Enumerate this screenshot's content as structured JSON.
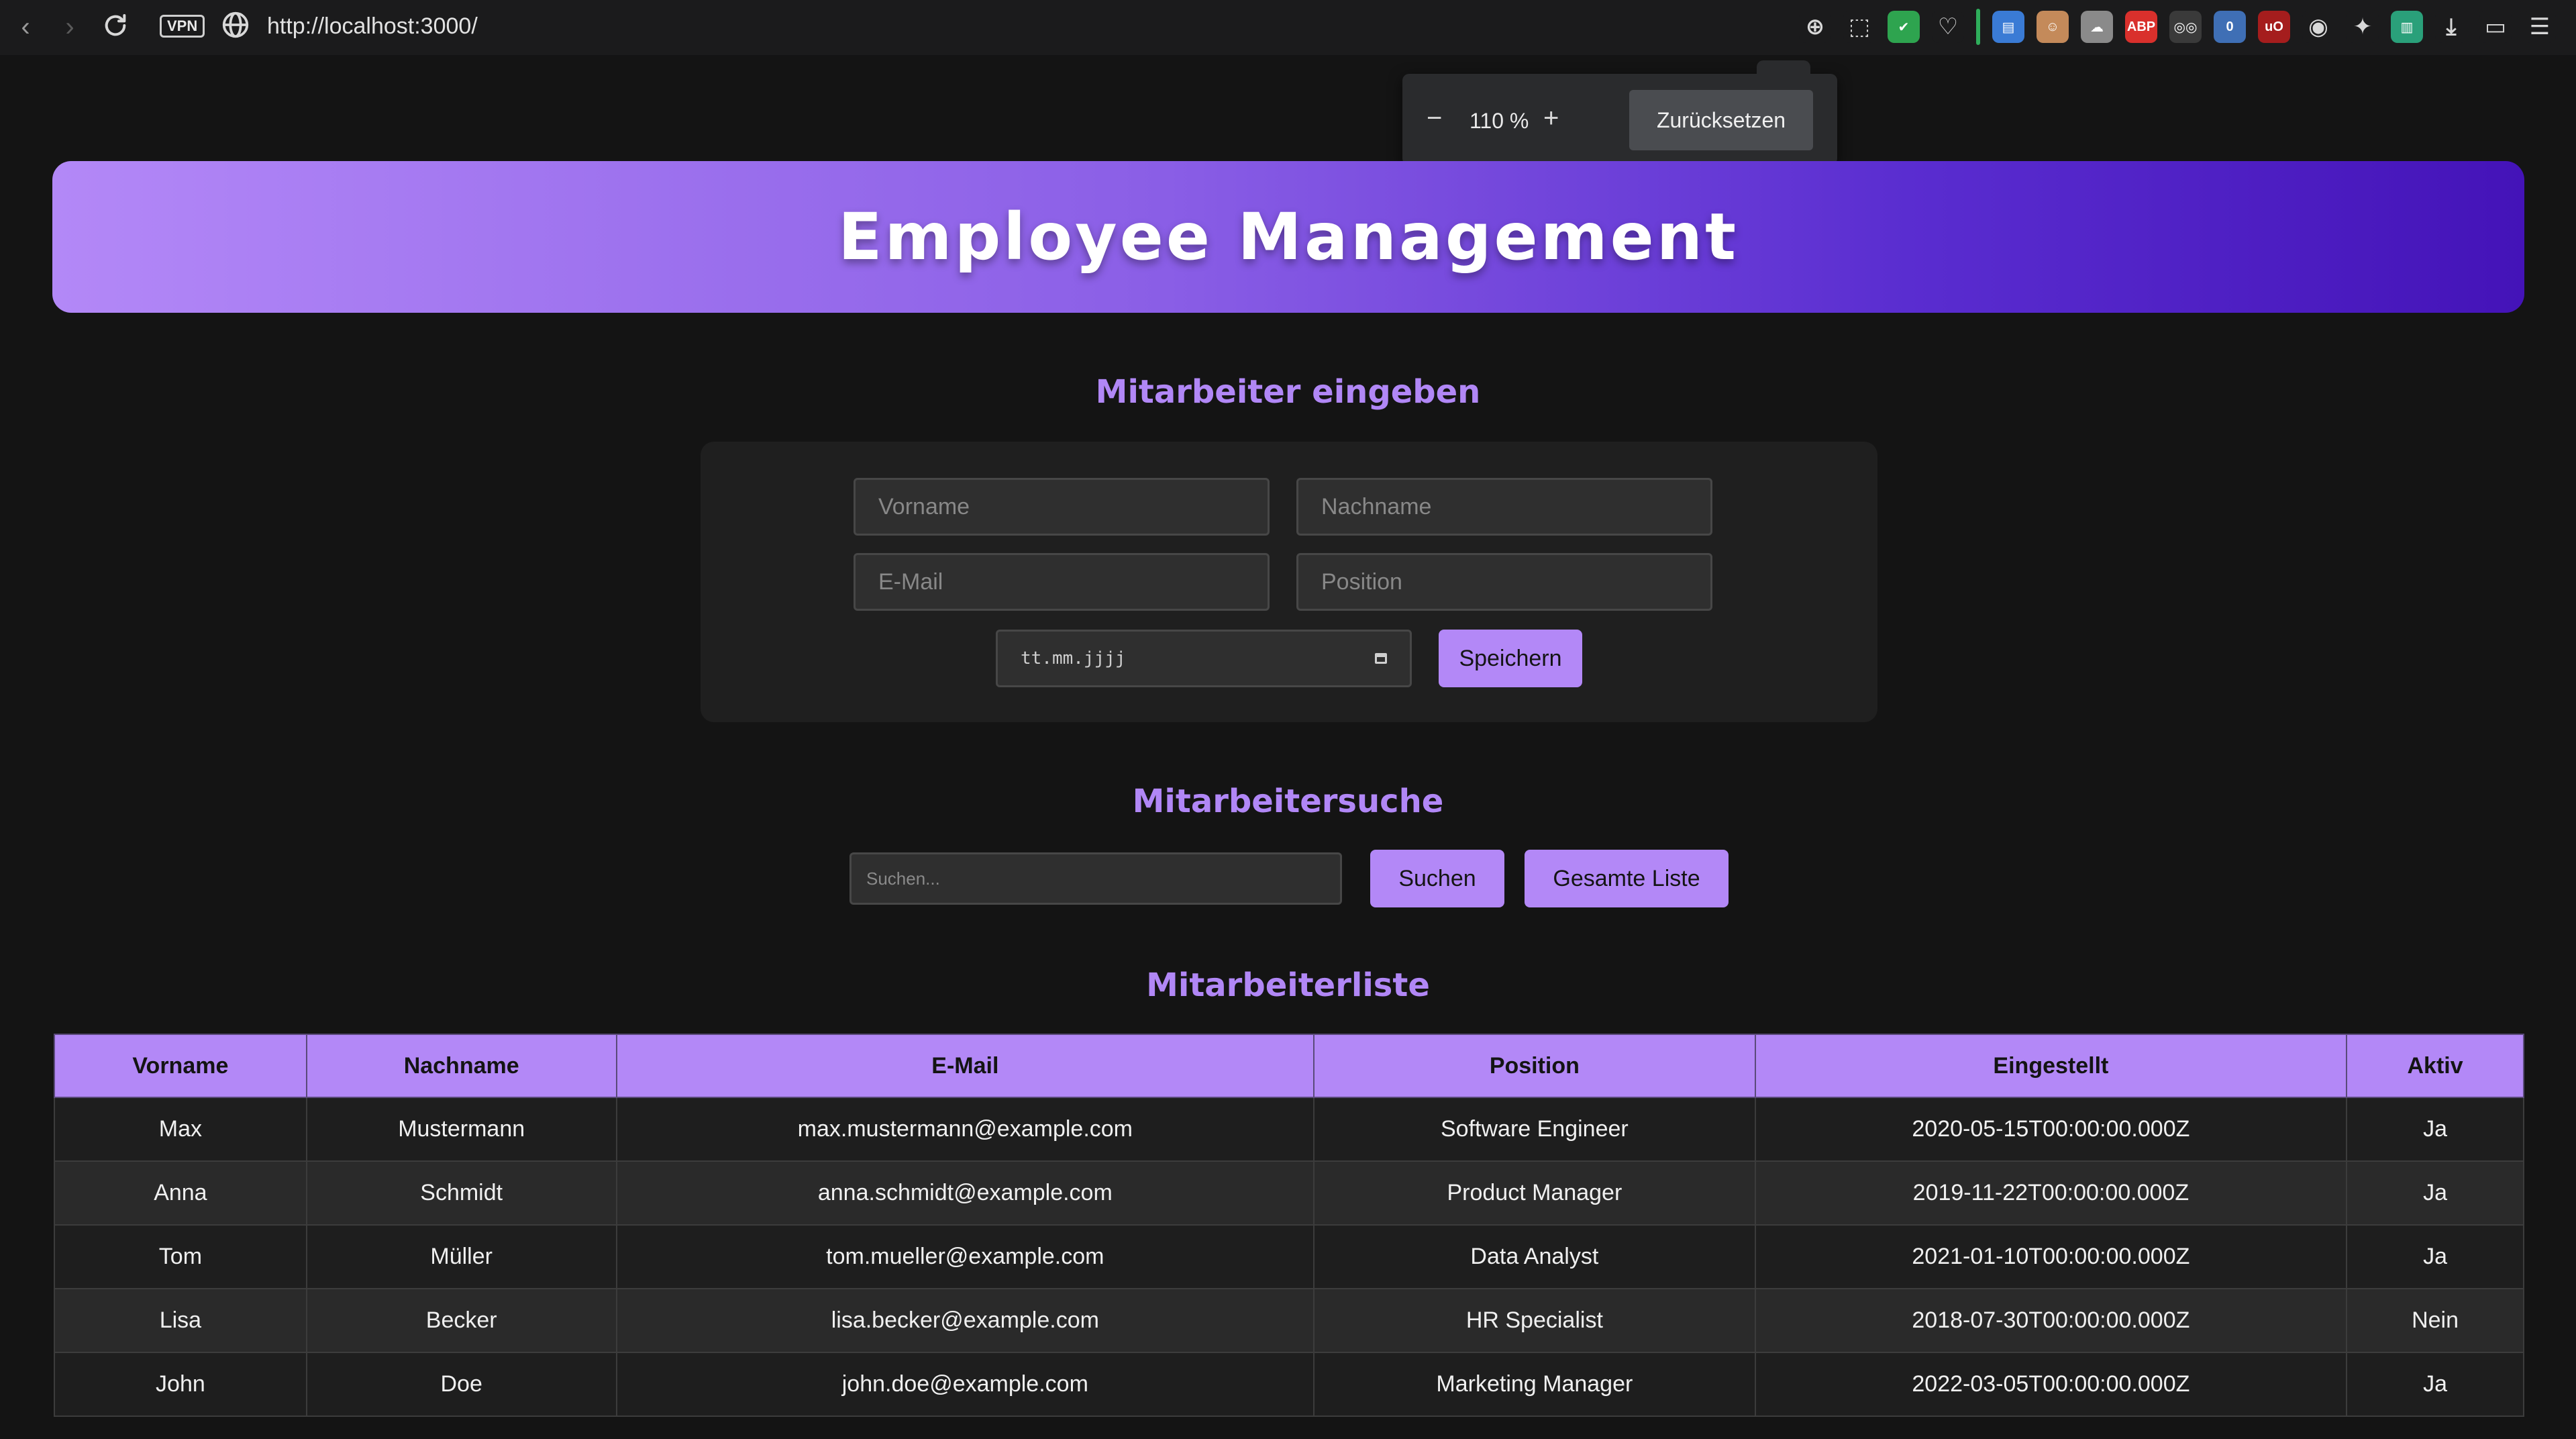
{
  "browser": {
    "url": "http://localhost:3000/",
    "vpn_label": "VPN",
    "extensions": [
      {
        "name": "zoom-icon",
        "label": "⊕",
        "color": "#1b1b1c"
      },
      {
        "name": "screenshot-icon",
        "label": "⬚",
        "color": "#1b1b1c"
      },
      {
        "name": "shield-extension-icon",
        "label": "✔",
        "color": "#2ea44f"
      },
      {
        "name": "heart-icon",
        "label": "♡",
        "color": "#1b1b1c"
      },
      {
        "name": "save-extension-icon",
        "label": "▤",
        "color": "#3a7bd5"
      },
      {
        "name": "face-extension-icon",
        "label": "☺",
        "color": "#c48a5a"
      },
      {
        "name": "cloud-extension-icon",
        "label": "☁",
        "color": "#8a8a8a"
      },
      {
        "name": "adblock-icon",
        "label": "ABP",
        "color": "#d9302c"
      },
      {
        "name": "glasses-extension-icon",
        "label": "◎◎",
        "color": "#3a3a3a"
      },
      {
        "name": "counter-extension-icon",
        "label": "0",
        "color": "#3f6fb5"
      },
      {
        "name": "ublock-icon",
        "label": "uO",
        "color": "#a51d1d"
      },
      {
        "name": "eye-extension-icon",
        "label": "◉",
        "color": "#1b1b1c"
      },
      {
        "name": "puzzle-icon",
        "label": "✦",
        "color": "#1b1b1c"
      },
      {
        "name": "stripe-extension-icon",
        "label": "▥",
        "color": "#2aa07a"
      },
      {
        "name": "download-icon",
        "label": "⤓",
        "color": "#1b1b1c"
      },
      {
        "name": "battery-icon",
        "label": "▭",
        "color": "#1b1b1c"
      },
      {
        "name": "menu-icon",
        "label": "☰",
        "color": "#1b1b1c"
      }
    ]
  },
  "zoom": {
    "minus": "−",
    "value": "110 %",
    "plus": "+",
    "reset_label": "Zurücksetzen"
  },
  "header": {
    "title": "Employee Management"
  },
  "form": {
    "title": "Mitarbeiter eingeben",
    "firstname_placeholder": "Vorname",
    "lastname_placeholder": "Nachname",
    "email_placeholder": "E-Mail",
    "position_placeholder": "Position",
    "date_placeholder": "tt.mm.jjjj",
    "save_label": "Speichern"
  },
  "search": {
    "title": "Mitarbeitersuche",
    "placeholder": "Suchen...",
    "search_label": "Suchen",
    "full_list_label": "Gesamte Liste"
  },
  "table": {
    "title": "Mitarbeiterliste",
    "headers": [
      "Vorname",
      "Nachname",
      "E-Mail",
      "Position",
      "Eingestellt",
      "Aktiv"
    ],
    "rows": [
      [
        "Max",
        "Mustermann",
        "max.mustermann@example.com",
        "Software Engineer",
        "2020-05-15T00:00:00.000Z",
        "Ja"
      ],
      [
        "Anna",
        "Schmidt",
        "anna.schmidt@example.com",
        "Product Manager",
        "2019-11-22T00:00:00.000Z",
        "Ja"
      ],
      [
        "Tom",
        "Müller",
        "tom.mueller@example.com",
        "Data Analyst",
        "2021-01-10T00:00:00.000Z",
        "Ja"
      ],
      [
        "Lisa",
        "Becker",
        "lisa.becker@example.com",
        "HR Specialist",
        "2018-07-30T00:00:00.000Z",
        "Nein"
      ],
      [
        "John",
        "Doe",
        "john.doe@example.com",
        "Marketing Manager",
        "2022-03-05T00:00:00.000Z",
        "Ja"
      ]
    ]
  },
  "colors": {
    "accent": "#b388f7",
    "background": "#141414",
    "banner_start": "#b388f7",
    "banner_end": "#4413b8"
  }
}
